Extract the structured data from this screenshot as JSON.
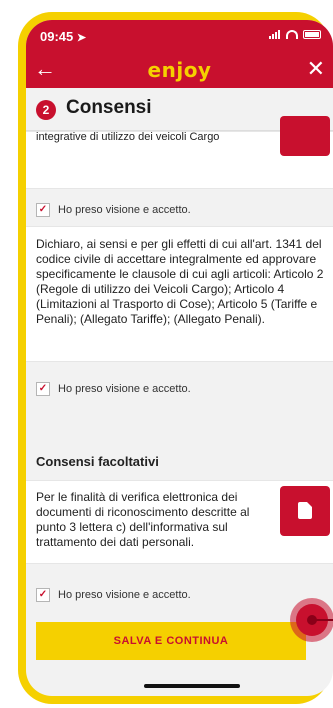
{
  "status_bar": {
    "time": "09:45",
    "location_glyph": "➤"
  },
  "nav": {
    "back_glyph": "←",
    "brand": "enjoy",
    "close_glyph": "✕"
  },
  "section": {
    "step_number": "2",
    "title": "Consensi"
  },
  "card_top": {
    "clipped_text": "integrative di utilizzo dei veicoli Cargo"
  },
  "checks": [
    {
      "label": "Ho preso visione e accetto.",
      "checked": true
    },
    {
      "label": "Ho preso visione e accetto.",
      "checked": true
    },
    {
      "label": "Ho preso visione e accetto.",
      "checked": true
    }
  ],
  "check_glyph": "✓",
  "declaration_text": "Dichiaro, ai sensi e per gli effetti di cui all'art. 1341 del codice civile di accettare integralmente ed approvare specificamente le clausole di cui agli articoli: Articolo 2 (Regole di utilizzo dei Veicoli Cargo); Articolo 4 (Limitazioni al Trasporto di Cose); Articolo 5 (Tariffe e Penali); (Allegato Tariffe); (Allegato Penali).",
  "optional": {
    "title": "Consensi facoltativi",
    "text": "Per le finalità di verifica elettronica dei documenti di riconoscimento descritte al punto 3 lettera c) dell'informativa sul trattamento dei dati personali."
  },
  "save_button": "SALVA E CONTINUA",
  "colors": {
    "brand_red": "#c8102e",
    "accent_yellow": "#f5d000"
  },
  "icons": [
    "location-arrow-icon",
    "signal-icon",
    "wifi-icon",
    "battery-icon",
    "back-arrow-icon",
    "close-icon",
    "pdf-document-icon",
    "checkbox-icon"
  ]
}
